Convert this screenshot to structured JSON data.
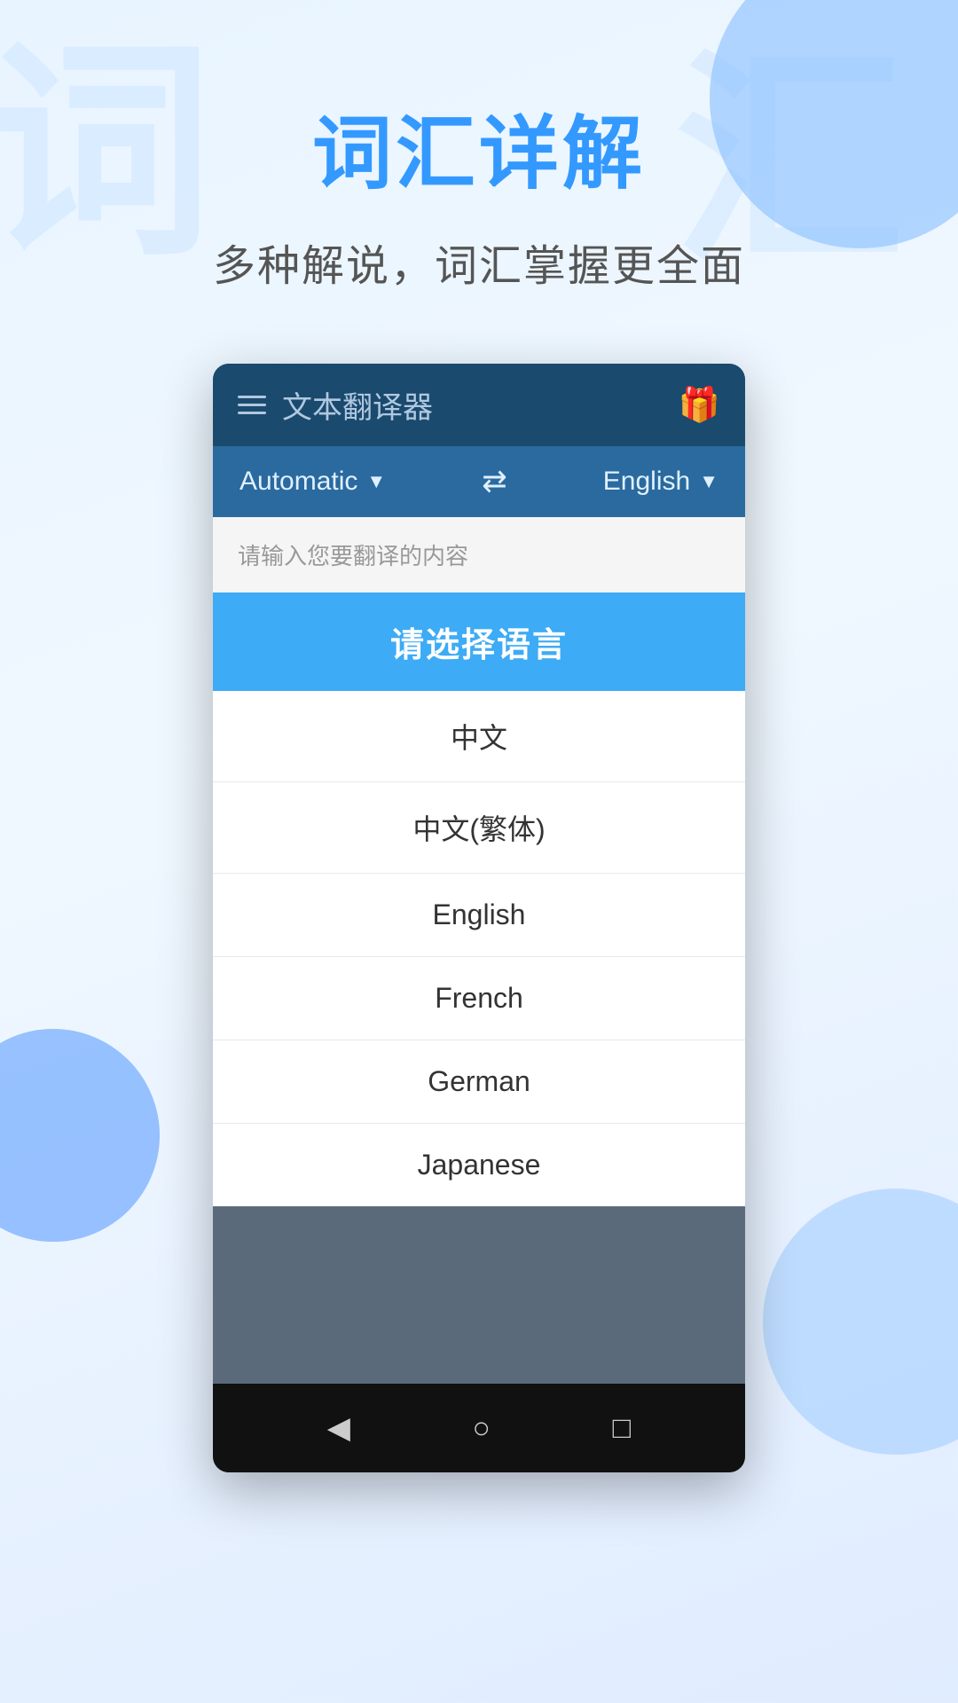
{
  "background": {
    "watermark_chars": [
      "词",
      "汇"
    ]
  },
  "header": {
    "main_title": "词汇详解",
    "subtitle": "多种解说，词汇掌握更全面"
  },
  "app": {
    "topbar": {
      "title": "文本翻译器",
      "gift_icon": "🎁"
    },
    "lang_bar": {
      "source_lang": "Automatic",
      "target_lang": "English",
      "swap_symbol": "⇄"
    },
    "input_placeholder": "请输入您要翻译的内容",
    "dialog": {
      "title": "请选择语言",
      "items": [
        {
          "id": "zh",
          "label": "中文"
        },
        {
          "id": "zh-tw",
          "label": "中文(繁体)"
        },
        {
          "id": "en",
          "label": "English"
        },
        {
          "id": "fr",
          "label": "French"
        },
        {
          "id": "de",
          "label": "German"
        },
        {
          "id": "ja",
          "label": "Japanese"
        }
      ]
    }
  },
  "nav": {
    "back_icon": "◀",
    "home_icon": "○",
    "recent_icon": "□"
  }
}
